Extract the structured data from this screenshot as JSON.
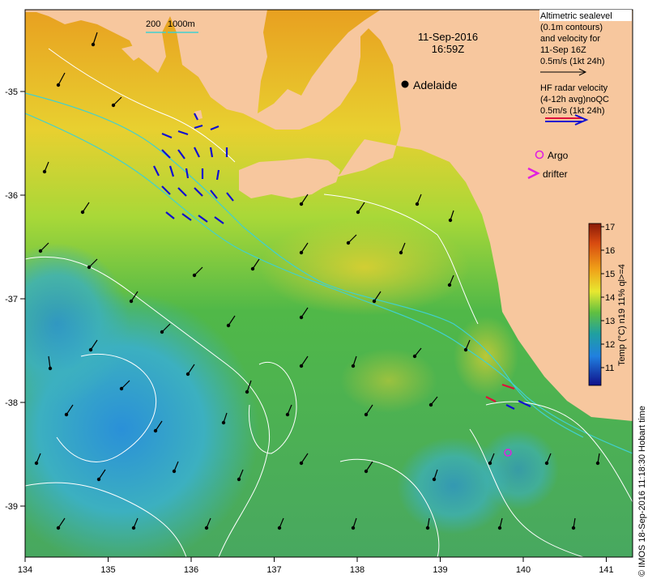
{
  "date_text": "11-Sep-2016",
  "time_text": "16:59Z",
  "city": {
    "name": "Adelaide"
  },
  "scale_bar": {
    "label_200": "200",
    "label_1000": "1000m"
  },
  "legend": {
    "altimetry": [
      "Altimetric sealevel",
      "(0.1m contours)",
      "and velocity for",
      "11-Sep 16Z",
      "0.5m/s (1kt 24h)"
    ],
    "hf_radar": [
      "HF radar velocity",
      "(4-12h avg)noQC",
      "0.5m/s (1kt 24h)"
    ],
    "argo_label": "Argo",
    "drifter_label": "drifter"
  },
  "colorbar": {
    "title": "Temp (°C) n19 11% ql>=4",
    "ticks": [
      "17",
      "16",
      "15",
      "14",
      "13",
      "12",
      "11"
    ],
    "range": [
      10.5,
      17.3
    ]
  },
  "credit": "© IMOS 18-Sep-2016 11:18:30 Hobart time",
  "x_ticks": [
    "134",
    "135",
    "136",
    "137",
    "138",
    "139",
    "140",
    "141"
  ],
  "y_ticks": [
    "-35",
    "-36",
    "-37",
    "-38",
    "-39"
  ],
  "colors": {
    "land": "#f7c79e",
    "warm_sst": "#f0a018",
    "mid_sst": "#7ec850",
    "cool_sst": "#36b0a8",
    "cold_sst": "#2a8ed8",
    "radar_red": "#e0103a",
    "radar_blue": "#1010d0",
    "argo": "#e020e0",
    "contour": "#ffffff",
    "bathy_200": "#40d0d0"
  }
}
